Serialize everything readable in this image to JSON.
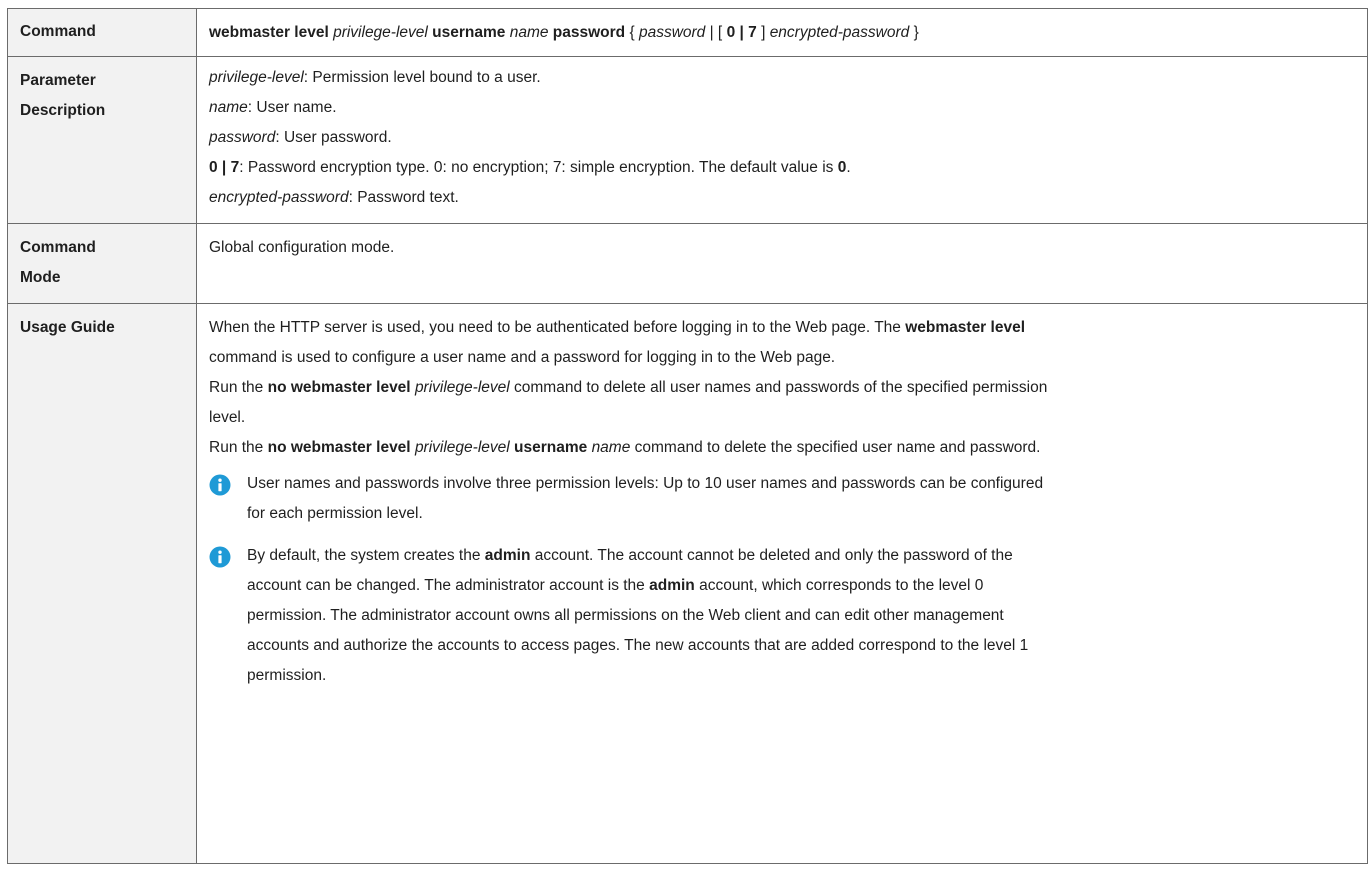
{
  "rows": {
    "command": {
      "label": "Command",
      "syntax": [
        {
          "t": "webmaster level",
          "s": "b"
        },
        {
          "t": " ",
          "s": ""
        },
        {
          "t": "privilege-level",
          "s": "i"
        },
        {
          "t": " ",
          "s": ""
        },
        {
          "t": "username",
          "s": "b"
        },
        {
          "t": " ",
          "s": ""
        },
        {
          "t": "name",
          "s": "i"
        },
        {
          "t": " ",
          "s": ""
        },
        {
          "t": "password",
          "s": "b"
        },
        {
          "t": " { ",
          "s": ""
        },
        {
          "t": "password",
          "s": "i"
        },
        {
          "t": " | [ ",
          "s": ""
        },
        {
          "t": "0 | 7",
          "s": "b"
        },
        {
          "t": " ] ",
          "s": ""
        },
        {
          "t": "encrypted-password",
          "s": "i"
        },
        {
          "t": " }",
          "s": ""
        }
      ]
    },
    "parameter_description": {
      "label_line1": "Parameter",
      "label_line2": "Description",
      "params": [
        {
          "name": "privilege-level",
          "style": "i",
          "desc": ": Permission level bound to a user."
        },
        {
          "name": "name",
          "style": "i",
          "desc": ": User name."
        },
        {
          "name": "password",
          "style": "i",
          "desc": ": User password."
        },
        {
          "name": "0 | 7",
          "style": "b",
          "desc": ": Password encryption type. 0: no encryption; 7: simple encryption. The default value is ",
          "tail_bold": "0",
          "tail": "."
        },
        {
          "name": "encrypted-password",
          "style": "i",
          "desc": ": Password text."
        }
      ]
    },
    "command_mode": {
      "label_line1": "Command",
      "label_line2": "Mode",
      "text": "Global configuration mode."
    },
    "usage_guide": {
      "label": "Usage Guide",
      "lines": [
        [
          {
            "t": "When the HTTP server is used, you need to be authenticated before logging in to the Web page. The ",
            "s": ""
          },
          {
            "t": "webmaster level",
            "s": "b"
          }
        ],
        [
          {
            "t": "command is used to configure a user name and a password for logging in to the Web page.",
            "s": ""
          }
        ],
        [
          {
            "t": "Run the ",
            "s": ""
          },
          {
            "t": "no webmaster level",
            "s": "b"
          },
          {
            "t": " ",
            "s": ""
          },
          {
            "t": "privilege-level",
            "s": "i"
          },
          {
            "t": " command to delete all user names and passwords of the specified permission",
            "s": ""
          }
        ],
        [
          {
            "t": "level.",
            "s": ""
          }
        ],
        [
          {
            "t": "Run the ",
            "s": ""
          },
          {
            "t": "no webmaster level",
            "s": "b"
          },
          {
            "t": " ",
            "s": ""
          },
          {
            "t": "privilege-level",
            "s": "i"
          },
          {
            "t": " ",
            "s": ""
          },
          {
            "t": "username",
            "s": "b"
          },
          {
            "t": " ",
            "s": ""
          },
          {
            "t": "name",
            "s": "i"
          },
          {
            "t": " command to delete the specified user name and password.",
            "s": ""
          }
        ]
      ],
      "notes": [
        {
          "icon": "info-icon",
          "lines": [
            [
              {
                "t": "User names and passwords involve three permission levels: Up to 10 user names and passwords can be configured",
                "s": ""
              }
            ],
            [
              {
                "t": "for each permission level.",
                "s": ""
              }
            ]
          ]
        },
        {
          "icon": "info-icon",
          "lines": [
            [
              {
                "t": "By default, the system creates the ",
                "s": ""
              },
              {
                "t": "admin",
                "s": "b"
              },
              {
                "t": " account. The account cannot be deleted and only the password of the",
                "s": ""
              }
            ],
            [
              {
                "t": "account can be changed. The administrator account is the ",
                "s": ""
              },
              {
                "t": "admin",
                "s": "b"
              },
              {
                "t": " account, which corresponds to the level 0",
                "s": ""
              }
            ],
            [
              {
                "t": "permission. The administrator account owns all permissions on the Web client and can edit other management",
                "s": ""
              }
            ],
            [
              {
                "t": "accounts and authorize the accounts to access pages. The new accounts that are added correspond to the level 1",
                "s": ""
              }
            ],
            [
              {
                "t": "permission.",
                "s": ""
              }
            ]
          ]
        }
      ]
    }
  },
  "colors": {
    "label_bg": "#f2f2f2",
    "border": "#6b6b6b",
    "icon_blue": "#1f9ad6"
  }
}
